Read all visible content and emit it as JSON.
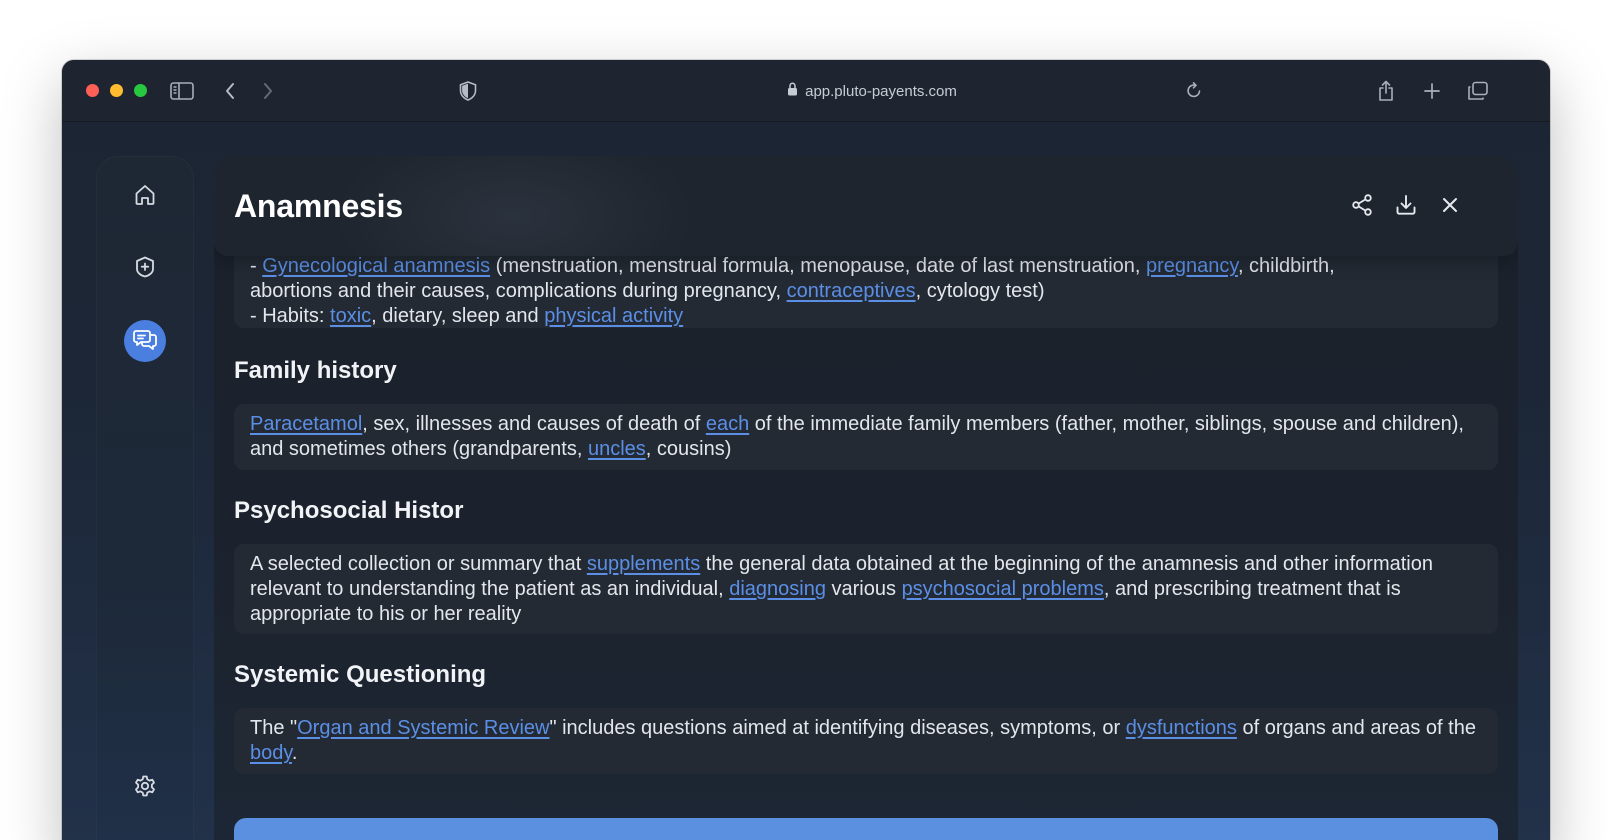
{
  "browser": {
    "url": "app.pluto-payents.com"
  },
  "panel": {
    "title": "Anamnesis"
  },
  "sections": {
    "top": {
      "line1": {
        "prefix": "- ",
        "link1": "Gynecological anamnesis",
        "text1": " (menstruation, menstrual formula, menopause, date of last menstruation, ",
        "link2": "pregnancy",
        "text2": ", childbirth,"
      },
      "line2": {
        "text1": "abortions and their causes, complications during pregnancy, ",
        "link1": "contraceptives",
        "text2": ", cytology test)"
      },
      "line3": {
        "text1": "- Habits: ",
        "link1": "toxic",
        "text2": ", dietary, sleep and ",
        "link2": "physical activity"
      }
    },
    "family": {
      "title": "Family history",
      "link1": "Paracetamol",
      "text1": ", sex, illnesses and causes of death of ",
      "link2": "each",
      "text2": " of the immediate family members (father, mother, siblings, spouse and children), and sometimes others (grandparents, ",
      "link3": "uncles",
      "text3": ", cousins)"
    },
    "psychosocial": {
      "title": "Psychosocial Histor",
      "text1": "A selected collection or summary that ",
      "link1": "supplements",
      "text2": " the general data obtained at the beginning of the anamnesis and other information relevant to understanding the patient as an individual, ",
      "link2": "diagnosing",
      "text3": " various ",
      "link3": "psychosocial problems",
      "text4": ", and prescribing treatment that is appropriate to his or her reality"
    },
    "systemic": {
      "title": "Systemic Questioning",
      "text1": "The \"",
      "link1": "Organ and Systemic Review",
      "text2": "\" includes questions aimed at identifying diseases, symptoms, or ",
      "link2": "dysfunctions",
      "text3": " of organs and areas of the ",
      "link3": "body",
      "text4": "."
    }
  },
  "colors": {
    "accent": "#4a7fe0",
    "link": "#5b8fe6"
  }
}
